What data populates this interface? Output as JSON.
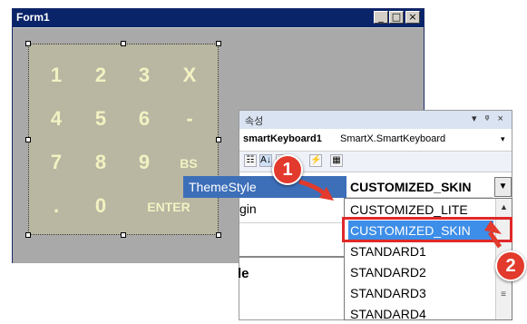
{
  "form": {
    "title": "Form1",
    "minimize": "_",
    "maximize": "□",
    "close": "×"
  },
  "keyboard": {
    "rows": [
      [
        "1",
        "2",
        "3",
        "X"
      ],
      [
        "4",
        "5",
        "6",
        "-"
      ],
      [
        "7",
        "8",
        "9",
        "BS"
      ],
      [
        ".",
        "0",
        "ENTER"
      ]
    ]
  },
  "properties": {
    "caption": "속성",
    "pin_controls": "▾ ᵠ ×",
    "object_name": "smartKeyboard1",
    "object_type": "SmartX.SmartKeyboard",
    "object_arrow": "▾",
    "tools": [
      "☷",
      "A↓",
      "▤",
      "⚡",
      "▦"
    ],
    "theme_label": "ThemeStyle",
    "theme_value": "CUSTOMIZED_SKIN",
    "theme_drop": "▼",
    "partial_row": "gin",
    "partial_section": "le"
  },
  "dropdown": {
    "options": [
      "CUSTOMIZED_LITE",
      "CUSTOMIZED_SKIN",
      "STANDARD1",
      "STANDARD2",
      "STANDARD3",
      "STANDARD4"
    ],
    "selected": "CUSTOMIZED_SKIN",
    "scroll_up": "▲",
    "scroll_grip": "≡"
  },
  "callouts": [
    "1",
    "2"
  ],
  "colors": {
    "highlight": "#3d8ee8",
    "callout": "#e23a2c",
    "title_bar": "#0a246a"
  }
}
